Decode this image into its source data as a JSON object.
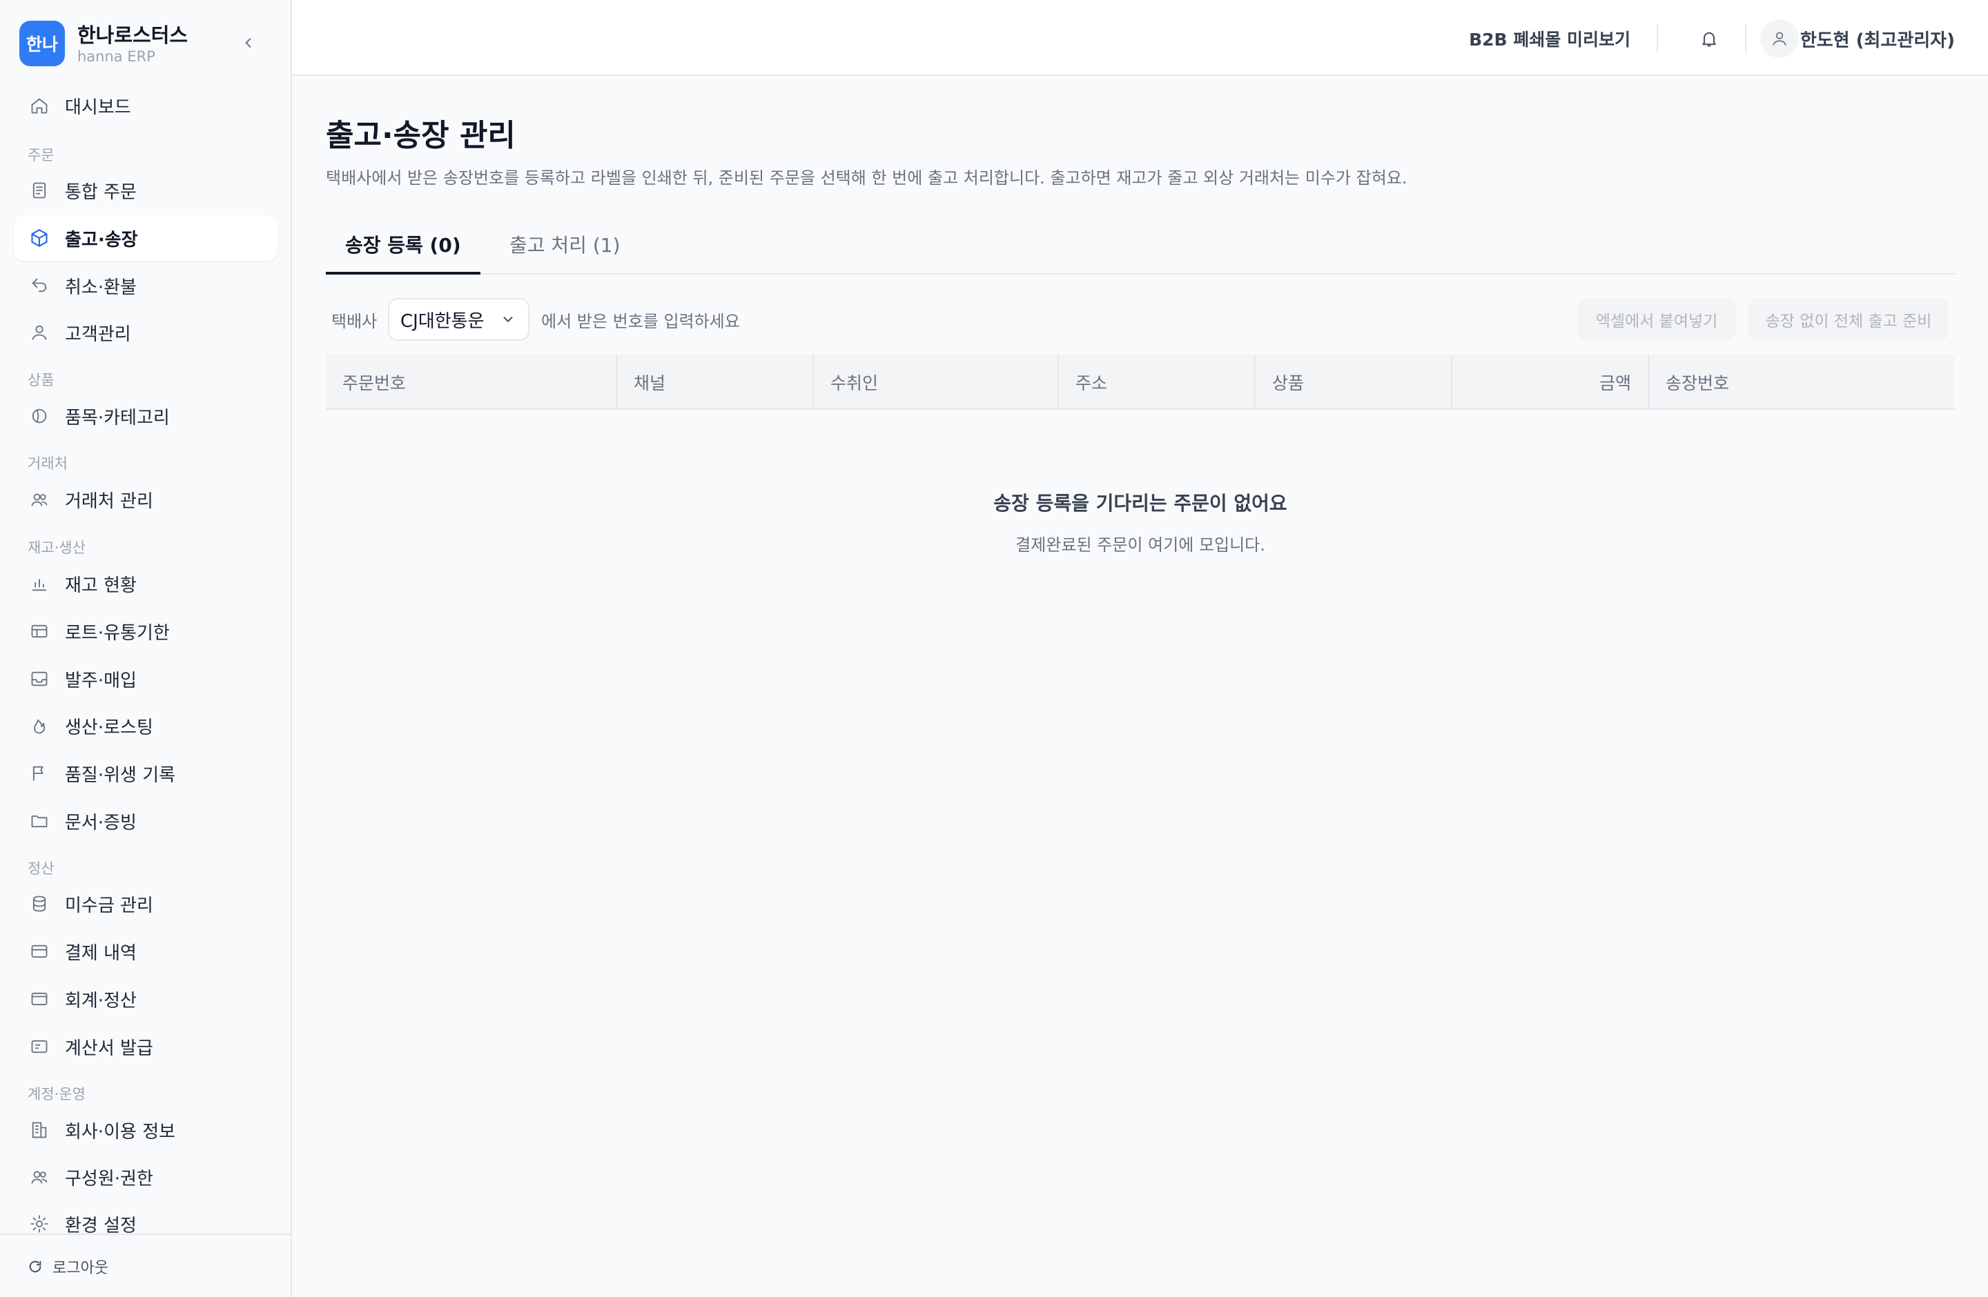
{
  "brand": {
    "logo_text": "한나",
    "name": "한나로스터스",
    "subtitle": "hanna ERP"
  },
  "sidebar": {
    "dashboard": "대시보드",
    "sections": {
      "orders": "주문",
      "products": "상품",
      "partners": "거래처",
      "inventory": "재고·생산",
      "settlement": "정산",
      "account": "계정·운영"
    },
    "items": [
      {
        "label": "통합 주문",
        "icon": "document-icon"
      },
      {
        "label": "출고·송장",
        "icon": "box-icon",
        "active": true
      },
      {
        "label": "취소·환불",
        "icon": "undo-icon"
      },
      {
        "label": "고객관리",
        "icon": "user-icon"
      },
      {
        "label": "품목·카테고리",
        "icon": "category-icon"
      },
      {
        "label": "거래처 관리",
        "icon": "users-icon"
      },
      {
        "label": "재고 현황",
        "icon": "bar-chart-icon"
      },
      {
        "label": "로트·유통기한",
        "icon": "table-icon"
      },
      {
        "label": "발주·매입",
        "icon": "inbox-icon"
      },
      {
        "label": "생산·로스팅",
        "icon": "flame-icon"
      },
      {
        "label": "품질·위생 기록",
        "icon": "flag-icon"
      },
      {
        "label": "문서·증빙",
        "icon": "folder-icon"
      },
      {
        "label": "미수금 관리",
        "icon": "database-icon"
      },
      {
        "label": "결제 내역",
        "icon": "card-icon"
      },
      {
        "label": "회계·정산",
        "icon": "wallet-icon"
      },
      {
        "label": "계산서 발급",
        "icon": "invoice-icon"
      },
      {
        "label": "회사·이용 정보",
        "icon": "building-icon"
      },
      {
        "label": "구성원·권한",
        "icon": "members-icon"
      },
      {
        "label": "환경 설정",
        "icon": "gear-icon"
      }
    ],
    "logout": "로그아웃"
  },
  "header": {
    "b2b_preview": "B2B 폐쇄몰 미리보기",
    "user": "한도현 (최고관리자)"
  },
  "main": {
    "title": "출고·송장 관리",
    "description": "택배사에서 받은 송장번호를 등록하고 라벨을 인쇄한 뒤, 준비된 주문을 선택해 한 번에 출고 처리합니다. 출고하면 재고가 줄고 외상 거래처는 미수가 잡혀요.",
    "tabs": [
      {
        "label": "송장 등록 (0)",
        "active": true
      },
      {
        "label": "출고 처리 (1)",
        "active": false
      }
    ],
    "carrier_label": "택배사",
    "carrier_value": "CJ대한통운",
    "carrier_hint": "에서 받은 번호를 입력하세요",
    "paste_button": "엑셀에서 붙여넣기",
    "prepare_all_button": "송장 없이 전체 출고 준비",
    "table_headers": [
      "주문번호",
      "채널",
      "수취인",
      "주소",
      "상품",
      "금액",
      "송장번호"
    ],
    "empty_title": "송장 등록을 기다리는 주문이 없어요",
    "empty_subtitle": "결제완료된 주문이 여기에 모입니다."
  },
  "colors": {
    "accent": "#2f7bf5",
    "active_icon": "#2563eb"
  }
}
